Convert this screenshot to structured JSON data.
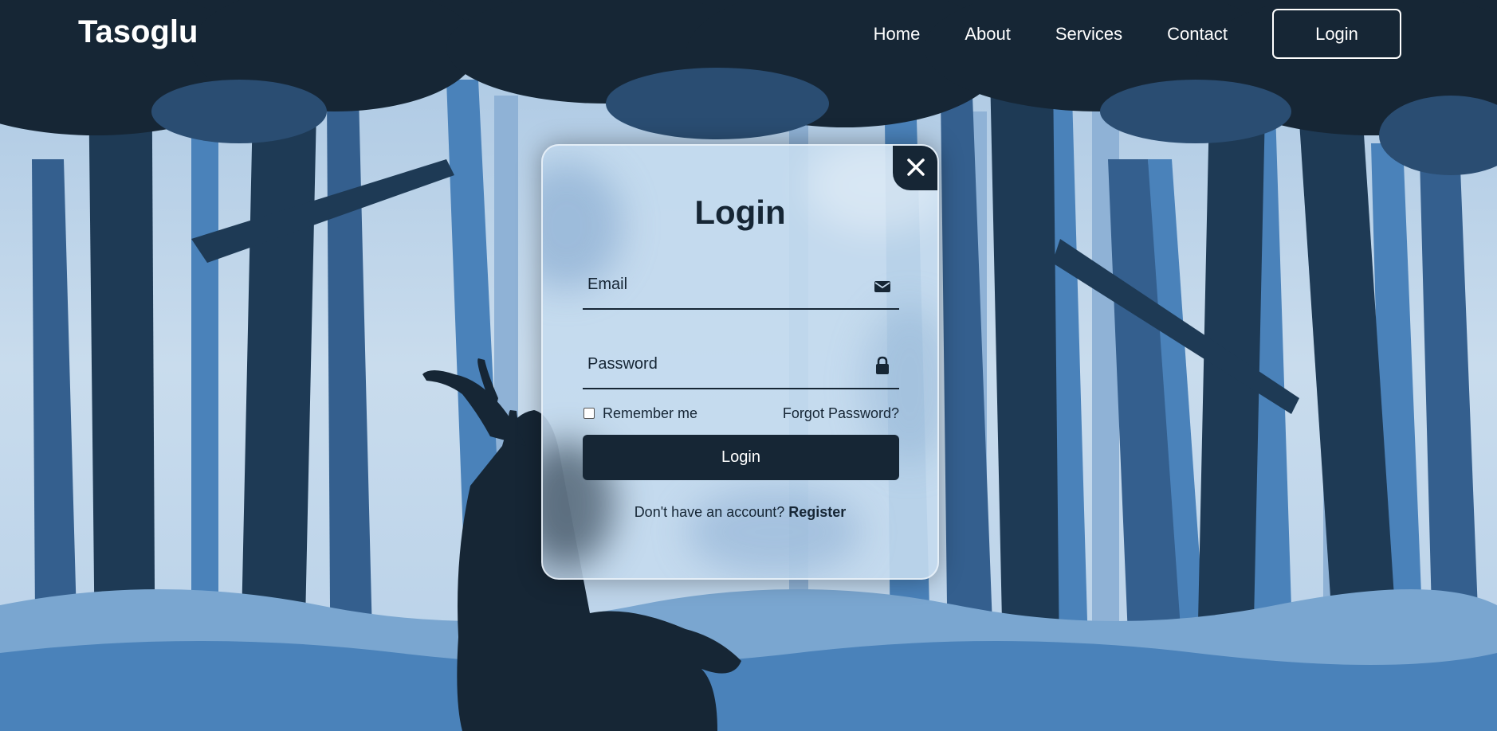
{
  "brand": {
    "logo": "Tasoglu"
  },
  "nav": {
    "items": [
      {
        "label": "Home"
      },
      {
        "label": "About"
      },
      {
        "label": "Services"
      },
      {
        "label": "Contact"
      }
    ],
    "login_button": "Login"
  },
  "modal": {
    "close_icon": "close-icon",
    "title": "Login",
    "email": {
      "placeholder": "Email",
      "value": "",
      "icon": "envelope-icon"
    },
    "password": {
      "placeholder": "Password",
      "value": "",
      "icon": "lock-icon"
    },
    "remember_label": "Remember me",
    "remember_checked": false,
    "forgot_label": "Forgot Password?",
    "submit_label": "Login",
    "register_prompt": "Don't have an account?",
    "register_link": "Register"
  },
  "colors": {
    "dark_navy": "#162635",
    "mist": "#c3d7ea",
    "mid_blue": "#4a82ba",
    "white": "#ffffff"
  }
}
